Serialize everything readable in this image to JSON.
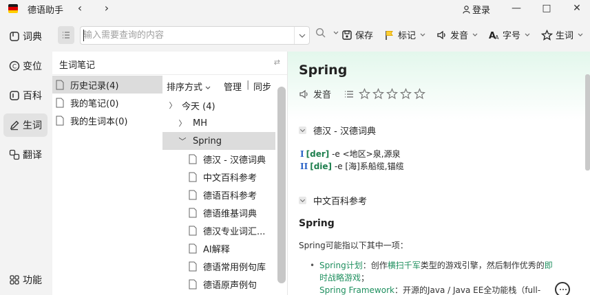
{
  "app": {
    "title": "德语助手",
    "flag_colors": [
      "#1a1a1a",
      "#dd0000",
      "#ffce00"
    ],
    "login_label": "登录",
    "win_controls": [
      "—",
      "□",
      "✕"
    ]
  },
  "nav": {
    "items": [
      {
        "label": "词典",
        "icon": "dictionary-icon"
      },
      {
        "label": "变位",
        "icon": "conjugation-icon"
      },
      {
        "label": "百科",
        "icon": "encyclopedia-icon"
      },
      {
        "label": "生词",
        "icon": "pen-icon",
        "active": true
      },
      {
        "label": "翻译",
        "icon": "translate-icon"
      }
    ],
    "bottom": {
      "label": "功能",
      "icon": "grid-icon"
    }
  },
  "toolbar": {
    "search_placeholder": "输入需要查询的内容",
    "save_label": "保存",
    "mark_label": "标记",
    "pronounce_label": "发音",
    "fontsize_label": "字号",
    "vocab_label": "生词"
  },
  "notes": {
    "title": "生词笔记",
    "sources": [
      {
        "label": "历史记录(4)",
        "active": true
      },
      {
        "label": "我的笔记(0)"
      },
      {
        "label": "我的生词本(0)"
      }
    ],
    "sort_label": "排序方式",
    "manage_label": "管理",
    "sync_label": "同步",
    "separator": "|",
    "tree": [
      {
        "label": "今天  (4)",
        "arrow": "collapsed",
        "level": 0
      },
      {
        "label": "MH",
        "arrow": "collapsed",
        "level": 1
      },
      {
        "label": "Spring",
        "arrow": "expanded",
        "level": 1,
        "selected": true
      },
      {
        "label": "德汉 - 汉德词典",
        "level": 2
      },
      {
        "label": "中文百科参考",
        "level": 2
      },
      {
        "label": "德语百科参考",
        "level": 2
      },
      {
        "label": "德语维基词典",
        "level": 2
      },
      {
        "label": "德汉专业词汇...",
        "level": 2
      },
      {
        "label": "AI解释",
        "level": 2
      },
      {
        "label": "德语常用例句库",
        "level": 2
      },
      {
        "label": "德语原声例句",
        "level": 2
      }
    ]
  },
  "entry": {
    "word": "Spring",
    "pronounce_label": "发音",
    "stars_total": 5,
    "stars_filled": 0,
    "sections": [
      {
        "title": "德汉 - 汉德词典",
        "definitions": [
          {
            "num": "I",
            "article": "[der]",
            "text": " -e <地区>泉,源泉"
          },
          {
            "num": "II",
            "article": "[die]",
            "text": " -e [海]系船缆,锚缆"
          }
        ]
      },
      {
        "title": "中文百科参考"
      }
    ],
    "wiki": {
      "heading": "Spring",
      "intro": "Spring可能指以下其中一项：",
      "items": [
        {
          "link": "Spring计划",
          "text_a": "：创作",
          "link2": "横扫千军",
          "text_b": "类型的游戏引擎，然后制作优秀的",
          "link3": "即时战略游戏",
          "text_c": "；"
        },
        {
          "link": "Spring Framework",
          "text_a": "：开源的Java / Java EE全功能栈（full-"
        }
      ]
    },
    "accent_color": "#1e8f5e",
    "number_color": "#2b63c7"
  }
}
